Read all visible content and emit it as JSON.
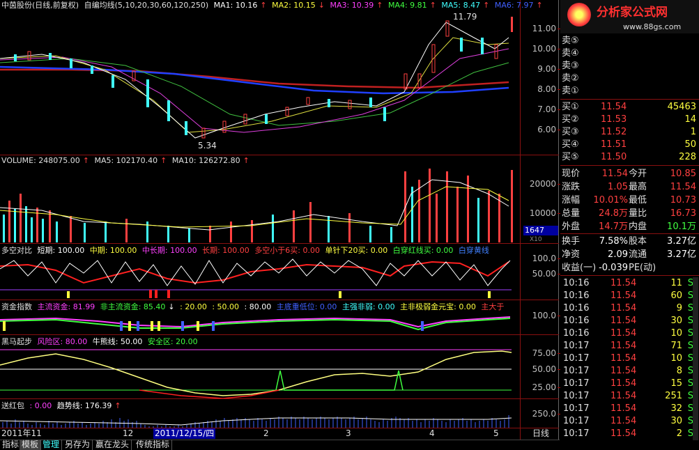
{
  "main_chart": {
    "title": "中茵股份(日线,前复权)",
    "indicator": "自编均线(5,10,20,30,60,120,250)",
    "ma1": "MA1: 10.16",
    "ma2": "MA2: 10.15",
    "ma3": "MA3: 10.39",
    "ma4": "MA4: 9.81",
    "ma5": "MA5: 8.47",
    "ma6": "MA6: 7.97",
    "high_label": "11.79",
    "low_label": "5.34",
    "yticks": [
      "11.00",
      "10.00",
      "9.00",
      "8.00",
      "7.00",
      "6.00"
    ]
  },
  "volume_chart": {
    "vol": "VOLUME: 248075.00",
    "ma5": "MA5: 102170.40",
    "ma10": "MA10: 126272.80",
    "yticks": [
      "20000",
      "10000"
    ],
    "cursor_value": "1647",
    "unit": "X10"
  },
  "duokong": {
    "title": "多空对比",
    "short": "短期: 100.00",
    "mid": "中期: 100.00",
    "midlong": "中长期: 100.00",
    "long": "长期: 100.00",
    "lt6": "多空小于6买: 0.00",
    "dz20": "单针下20买: 0.00",
    "bchx": "白穿红线买: 0.00",
    "bchy": "白穿黄线",
    "yticks": [
      "100.0",
      "50.00"
    ]
  },
  "zijin": {
    "title": "资金指数",
    "main": "主流资金: 81.99",
    "nonmain": "非主流资金: 85.40",
    "v20": ": 20.00",
    "v50": ": 50.00",
    "v80": ": 80.00",
    "low": "主底重低位: 0.00",
    "strong": "主强非弱: 0.00",
    "weak": "主非极弱金元宝: 0.00",
    "big": "主大于",
    "yticks": [
      "100.0"
    ]
  },
  "heima": {
    "title": "黑马起步",
    "risk": "风险区: 80.00",
    "bull": "牛熊线: 50.00",
    "safe": "安全区: 20.00",
    "yticks": [
      "75.00",
      "50.00",
      "25.00"
    ]
  },
  "songhongbao": {
    "title": "送红包",
    "v1": ": 0.00",
    "trend": "趋势线: 176.39",
    "yticks": [
      "250.0"
    ]
  },
  "xaxis": {
    "labels": [
      "2011年11",
      "12",
      "2",
      "3",
      "4",
      "5"
    ],
    "cursor_date": "2011/12/15/四",
    "period": "日线"
  },
  "tabs": [
    "指标",
    "模板",
    "管理",
    "另存为",
    "赢在龙头",
    "传统指标"
  ],
  "brand": {
    "name": "分析家公式网",
    "url": "www.88gs.com"
  },
  "order_book": {
    "sells": [
      {
        "label": "卖⑤",
        "price": "",
        "vol": ""
      },
      {
        "label": "卖④",
        "price": "",
        "vol": ""
      },
      {
        "label": "卖③",
        "price": "",
        "vol": ""
      },
      {
        "label": "卖②",
        "price": "",
        "vol": ""
      },
      {
        "label": "卖①",
        "price": "",
        "vol": ""
      }
    ],
    "buys": [
      {
        "label": "买①",
        "price": "11.54",
        "vol": "45463"
      },
      {
        "label": "买②",
        "price": "11.53",
        "vol": "14"
      },
      {
        "label": "买③",
        "price": "11.52",
        "vol": "1"
      },
      {
        "label": "买④",
        "price": "11.51",
        "vol": "50"
      },
      {
        "label": "买⑤",
        "price": "11.50",
        "vol": "228"
      }
    ]
  },
  "quote": [
    {
      "k1": "现价",
      "v1": "11.54",
      "k2": "今开",
      "v2": "10.85"
    },
    {
      "k1": "涨跌",
      "v1": "1.05",
      "k2": "最高",
      "v2": "11.54"
    },
    {
      "k1": "涨幅",
      "v1": "10.01%",
      "k2": "最低",
      "v2": "10.73"
    },
    {
      "k1": "总量",
      "v1": "24.8万",
      "k2": "量比",
      "v2": "16.73"
    },
    {
      "k1": "外盘",
      "v1": "14.7万",
      "k2": "内盘",
      "v2": "10.1万"
    }
  ],
  "stats": [
    {
      "k1": "换手",
      "v1": "7.58%",
      "k2": "股本",
      "v2": "3.27亿"
    },
    {
      "k1": "净资",
      "v1": "2.09",
      "k2": "流通",
      "v2": "3.27亿"
    },
    {
      "k1": "收益(一)",
      "v1": "-0.039",
      "k2": "PE(动)",
      "v2": ""
    }
  ],
  "ticks": [
    {
      "time": "10:16",
      "price": "11.54",
      "vol": "11",
      "side": "S"
    },
    {
      "time": "10:16",
      "price": "11.54",
      "vol": "60",
      "side": "S"
    },
    {
      "time": "10:16",
      "price": "11.54",
      "vol": "9",
      "side": "S"
    },
    {
      "time": "10:16",
      "price": "11.54",
      "vol": "30",
      "side": "S"
    },
    {
      "time": "10:16",
      "price": "11.54",
      "vol": "10",
      "side": "S"
    },
    {
      "time": "10:17",
      "price": "11.54",
      "vol": "71",
      "side": "S"
    },
    {
      "time": "10:17",
      "price": "11.54",
      "vol": "10",
      "side": "S"
    },
    {
      "time": "10:17",
      "price": "11.54",
      "vol": "8",
      "side": "S"
    },
    {
      "time": "10:17",
      "price": "11.54",
      "vol": "15",
      "side": "S"
    },
    {
      "time": "10:17",
      "price": "11.54",
      "vol": "251",
      "side": "S"
    },
    {
      "time": "10:17",
      "price": "11.54",
      "vol": "32",
      "side": "S"
    },
    {
      "time": "10:17",
      "price": "11.54",
      "vol": "30",
      "side": "S"
    },
    {
      "time": "10:17",
      "price": "11.54",
      "vol": "2",
      "side": "S"
    }
  ],
  "colors": {
    "up": "#ff4040",
    "down": "#40ffff",
    "grid": "#8a1010"
  }
}
